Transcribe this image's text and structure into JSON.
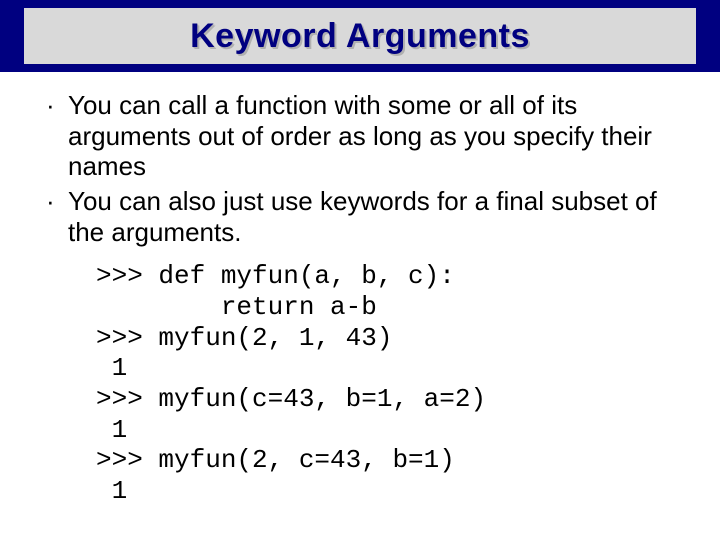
{
  "title": "Keyword Arguments",
  "bullets": [
    "You can call a function with some or all of its arguments out of order as long as you specify their names",
    "You can also just use keywords for a final subset of the arguments."
  ],
  "bullet_marker": "·",
  "code": ">>> def myfun(a, b, c):\n        return a-b\n>>> myfun(2, 1, 43)\n 1\n>>> myfun(c=43, b=1, a=2)\n 1\n>>> myfun(2, c=43, b=1)\n 1"
}
